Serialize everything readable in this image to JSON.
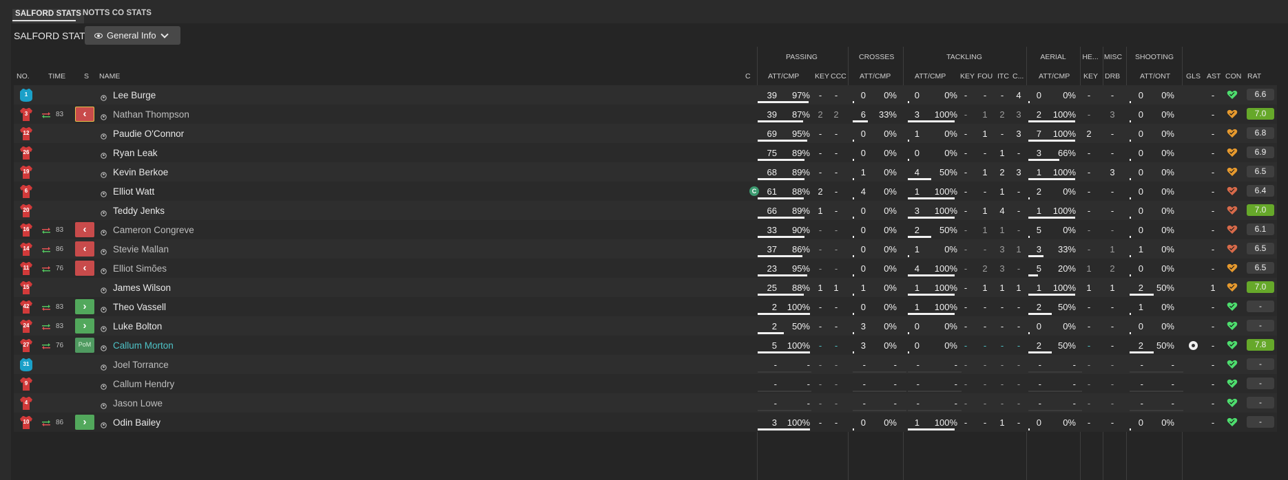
{
  "tabs": [
    {
      "label": "SALFORD STATS",
      "active": true
    },
    {
      "label": "NOTTS CO STATS",
      "active": false
    }
  ],
  "title": "SALFORD STATS",
  "view_selector": {
    "label": "General Info",
    "icon": "eye-icon"
  },
  "groups": {
    "passing": "PASSING",
    "crosses": "CROSSES",
    "tackling": "TACKLING",
    "aerial": "AERIAL",
    "headers": "HE...",
    "misc": "MISC",
    "shooting": "SHOOTING"
  },
  "columns": {
    "no": "NO.",
    "time": "TIME",
    "s": "S",
    "name": "NAME",
    "c": "C",
    "pass_att": "ATT/CMP",
    "key": "KEY",
    "ccc": "CCC",
    "cross_att": "ATT/CMP",
    "tack_att": "ATT/CMP",
    "tack_key": "KEY",
    "fou": "FOU",
    "itc": "ITC",
    "c2": "C...",
    "aerial_att": "ATT/CMP",
    "head_key": "KEY",
    "drb": "DRB",
    "shot_att": "ATT/ONT",
    "gls": "GLS",
    "ast": "AST",
    "con": "CON",
    "rat": "RAT"
  },
  "colors": {
    "shirt_red": "#d23a3a",
    "keeper_blue": "#1aa0c8",
    "sub_off": "#c84b4b",
    "sub_on": "#52a85c",
    "rating_green": "#66a82a",
    "pom_name": "#4ec3c7"
  },
  "players": [
    {
      "no": "1",
      "shirt": "keeper",
      "name": "Lee Burge",
      "swap": "",
      "time": "",
      "sub": "",
      "cap": false,
      "pa": "39",
      "pp": "97%",
      "pb": 0.97,
      "key": "-",
      "ccc": "-",
      "ca": "0",
      "cp": "0%",
      "cb": 0,
      "ta": "0",
      "tp": "0%",
      "tb": 0,
      "tk": "-",
      "fou": "-",
      "itc": "-",
      "c2": "4",
      "aa": "0",
      "ap": "0%",
      "ab": 0,
      "hk": "-",
      "drb": "-",
      "sa": "0",
      "sp": "0%",
      "sb": 0,
      "gls": "",
      "ast": "-",
      "con": "#4ede6e",
      "rat": "6.6",
      "ratg": false,
      "dim": false,
      "pom": false
    },
    {
      "no": "3",
      "shirt": "red",
      "name": "Nathan Thompson",
      "swap": "off",
      "time": "83",
      "sub": "off-hl",
      "cap": false,
      "pa": "39",
      "pp": "87%",
      "pb": 0.87,
      "key": "2",
      "ccc": "2",
      "ca": "6",
      "cp": "33%",
      "cb": 0.33,
      "ta": "3",
      "tp": "100%",
      "tb": 1,
      "tk": "-",
      "fou": "1",
      "itc": "2",
      "c2": "3",
      "aa": "2",
      "ap": "100%",
      "ab": 1,
      "hk": "-",
      "drb": "3",
      "sa": "0",
      "sp": "0%",
      "sb": 0,
      "gls": "",
      "ast": "-",
      "con": "#e79a2e",
      "rat": "7.0",
      "ratg": true,
      "dim": true,
      "pom": false
    },
    {
      "no": "12",
      "shirt": "red",
      "name": "Paudie O'Connor",
      "swap": "",
      "time": "",
      "sub": "",
      "cap": false,
      "pa": "69",
      "pp": "95%",
      "pb": 0.95,
      "key": "-",
      "ccc": "-",
      "ca": "0",
      "cp": "0%",
      "cb": 0,
      "ta": "1",
      "tp": "0%",
      "tb": 0,
      "tk": "-",
      "fou": "1",
      "itc": "-",
      "c2": "3",
      "aa": "7",
      "ap": "100%",
      "ab": 1,
      "hk": "2",
      "drb": "-",
      "sa": "0",
      "sp": "0%",
      "sb": 0,
      "gls": "",
      "ast": "-",
      "con": "#e79a2e",
      "rat": "6.8",
      "ratg": false,
      "dim": false,
      "pom": false
    },
    {
      "no": "26",
      "shirt": "red",
      "name": "Ryan Leak",
      "swap": "",
      "time": "",
      "sub": "",
      "cap": false,
      "pa": "75",
      "pp": "89%",
      "pb": 0.89,
      "key": "-",
      "ccc": "-",
      "ca": "0",
      "cp": "0%",
      "cb": 0,
      "ta": "0",
      "tp": "0%",
      "tb": 0,
      "tk": "-",
      "fou": "-",
      "itc": "1",
      "c2": "-",
      "aa": "3",
      "ap": "66%",
      "ab": 0.66,
      "hk": "-",
      "drb": "-",
      "sa": "0",
      "sp": "0%",
      "sb": 0,
      "gls": "",
      "ast": "-",
      "con": "#e79a2e",
      "rat": "6.9",
      "ratg": false,
      "dim": false,
      "pom": false
    },
    {
      "no": "19",
      "shirt": "red",
      "name": "Kevin Berkoe",
      "swap": "",
      "time": "",
      "sub": "",
      "cap": false,
      "pa": "68",
      "pp": "89%",
      "pb": 0.89,
      "key": "-",
      "ccc": "-",
      "ca": "1",
      "cp": "0%",
      "cb": 0,
      "ta": "4",
      "tp": "50%",
      "tb": 0.5,
      "tk": "-",
      "fou": "1",
      "itc": "2",
      "c2": "3",
      "aa": "1",
      "ap": "100%",
      "ab": 1,
      "hk": "-",
      "drb": "3",
      "sa": "0",
      "sp": "0%",
      "sb": 0,
      "gls": "",
      "ast": "-",
      "con": "#e79a2e",
      "rat": "6.5",
      "ratg": false,
      "dim": false,
      "pom": false
    },
    {
      "no": "6",
      "shirt": "red",
      "name": "Elliot Watt",
      "swap": "",
      "time": "",
      "sub": "",
      "cap": true,
      "cap_label": "C",
      "pa": "61",
      "pp": "88%",
      "pb": 0.88,
      "key": "2",
      "ccc": "-",
      "ca": "4",
      "cp": "0%",
      "cb": 0,
      "ta": "1",
      "tp": "100%",
      "tb": 1,
      "tk": "-",
      "fou": "-",
      "itc": "1",
      "c2": "-",
      "aa": "2",
      "ap": "0%",
      "ab": 0,
      "hk": "-",
      "drb": "-",
      "sa": "0",
      "sp": "0%",
      "sb": 0,
      "gls": "",
      "ast": "-",
      "con": "#d86a4a",
      "rat": "6.4",
      "ratg": false,
      "dim": false,
      "pom": false
    },
    {
      "no": "20",
      "shirt": "red",
      "name": "Teddy Jenks",
      "swap": "",
      "time": "",
      "sub": "",
      "cap": false,
      "pa": "66",
      "pp": "89%",
      "pb": 0.89,
      "key": "1",
      "ccc": "-",
      "ca": "0",
      "cp": "0%",
      "cb": 0,
      "ta": "3",
      "tp": "100%",
      "tb": 1,
      "tk": "-",
      "fou": "1",
      "itc": "4",
      "c2": "-",
      "aa": "1",
      "ap": "100%",
      "ab": 1,
      "hk": "-",
      "drb": "-",
      "sa": "0",
      "sp": "0%",
      "sb": 0,
      "gls": "",
      "ast": "-",
      "con": "#d86a4a",
      "rat": "7.0",
      "ratg": true,
      "dim": false,
      "pom": false
    },
    {
      "no": "16",
      "shirt": "red",
      "name": "Cameron Congreve",
      "swap": "off",
      "time": "83",
      "sub": "off",
      "cap": false,
      "pa": "33",
      "pp": "90%",
      "pb": 0.9,
      "key": "-",
      "ccc": "-",
      "ca": "0",
      "cp": "0%",
      "cb": 0,
      "ta": "2",
      "tp": "50%",
      "tb": 0.5,
      "tk": "-",
      "fou": "1",
      "itc": "1",
      "c2": "-",
      "aa": "5",
      "ap": "0%",
      "ab": 0,
      "hk": "-",
      "drb": "-",
      "sa": "0",
      "sp": "0%",
      "sb": 0,
      "gls": "",
      "ast": "-",
      "con": "#d86a4a",
      "rat": "6.1",
      "ratg": false,
      "dim": true,
      "pom": false
    },
    {
      "no": "14",
      "shirt": "red",
      "name": "Stevie Mallan",
      "swap": "off",
      "time": "86",
      "sub": "off",
      "cap": false,
      "pa": "37",
      "pp": "86%",
      "pb": 0.86,
      "key": "-",
      "ccc": "-",
      "ca": "0",
      "cp": "0%",
      "cb": 0,
      "ta": "1",
      "tp": "0%",
      "tb": 0,
      "tk": "-",
      "fou": "-",
      "itc": "3",
      "c2": "1",
      "aa": "3",
      "ap": "33%",
      "ab": 0.33,
      "hk": "-",
      "drb": "1",
      "sa": "1",
      "sp": "0%",
      "sb": 0,
      "gls": "",
      "ast": "-",
      "con": "#d86a4a",
      "rat": "6.5",
      "ratg": false,
      "dim": true,
      "pom": false
    },
    {
      "no": "11",
      "shirt": "red",
      "name": "Elliot Simões",
      "swap": "off",
      "time": "76",
      "sub": "off",
      "cap": false,
      "pa": "23",
      "pp": "95%",
      "pb": 0.95,
      "key": "-",
      "ccc": "-",
      "ca": "0",
      "cp": "0%",
      "cb": 0,
      "ta": "4",
      "tp": "100%",
      "tb": 1,
      "tk": "-",
      "fou": "2",
      "itc": "3",
      "c2": "-",
      "aa": "5",
      "ap": "20%",
      "ab": 0.2,
      "hk": "1",
      "drb": "2",
      "sa": "0",
      "sp": "0%",
      "sb": 0,
      "gls": "",
      "ast": "-",
      "con": "#e79a2e",
      "rat": "6.5",
      "ratg": false,
      "dim": true,
      "pom": false
    },
    {
      "no": "15",
      "shirt": "red",
      "name": "James Wilson",
      "swap": "",
      "time": "",
      "sub": "",
      "cap": false,
      "pa": "25",
      "pp": "88%",
      "pb": 0.88,
      "key": "1",
      "ccc": "1",
      "ca": "1",
      "cp": "0%",
      "cb": 0,
      "ta": "1",
      "tp": "100%",
      "tb": 1,
      "tk": "-",
      "fou": "1",
      "itc": "1",
      "c2": "1",
      "aa": "1",
      "ap": "100%",
      "ab": 1,
      "hk": "1",
      "drb": "1",
      "sa": "2",
      "sp": "50%",
      "sb": 0.5,
      "gls": "",
      "ast": "1",
      "con": "#e79a2e",
      "rat": "7.0",
      "ratg": true,
      "dim": false,
      "pom": false
    },
    {
      "no": "42",
      "shirt": "red",
      "name": "Theo Vassell",
      "swap": "on",
      "time": "83",
      "sub": "on",
      "cap": false,
      "pa": "2",
      "pp": "100%",
      "pb": 1,
      "key": "-",
      "ccc": "-",
      "ca": "0",
      "cp": "0%",
      "cb": 0,
      "ta": "1",
      "tp": "100%",
      "tb": 1,
      "tk": "-",
      "fou": "-",
      "itc": "-",
      "c2": "-",
      "aa": "2",
      "ap": "50%",
      "ab": 0.5,
      "hk": "-",
      "drb": "-",
      "sa": "1",
      "sp": "0%",
      "sb": 0,
      "gls": "",
      "ast": "-",
      "con": "#4ede6e",
      "rat": "-",
      "ratg": false,
      "dim": false,
      "pom": false
    },
    {
      "no": "24",
      "shirt": "red",
      "name": "Luke Bolton",
      "swap": "on",
      "time": "83",
      "sub": "on",
      "cap": false,
      "pa": "2",
      "pp": "50%",
      "pb": 0.5,
      "key": "-",
      "ccc": "-",
      "ca": "3",
      "cp": "0%",
      "cb": 0,
      "ta": "0",
      "tp": "0%",
      "tb": 0,
      "tk": "-",
      "fou": "-",
      "itc": "-",
      "c2": "-",
      "aa": "0",
      "ap": "0%",
      "ab": 0,
      "hk": "-",
      "drb": "-",
      "sa": "0",
      "sp": "0%",
      "sb": 0,
      "gls": "",
      "ast": "-",
      "con": "#4ede6e",
      "rat": "-",
      "ratg": false,
      "dim": false,
      "pom": false
    },
    {
      "no": "27",
      "shirt": "red",
      "name": "Callum Morton",
      "swap": "on",
      "time": "76",
      "sub": "pom",
      "sub_label": "PoM",
      "cap": false,
      "pa": "5",
      "pp": "100%",
      "pb": 1,
      "key": "-",
      "ccc": "-",
      "ca": "3",
      "cp": "0%",
      "cb": 0,
      "ta": "0",
      "tp": "0%",
      "tb": 0,
      "tk": "-",
      "fou": "-",
      "itc": "-",
      "c2": "-",
      "aa": "2",
      "ap": "50%",
      "ab": 0.5,
      "hk": "-",
      "drb": "-",
      "sa": "2",
      "sp": "50%",
      "sb": 0.5,
      "gls": "ball",
      "ast": "-",
      "con": "#4ede6e",
      "rat": "7.8",
      "ratg": true,
      "dim": false,
      "pom": true
    },
    {
      "no": "31",
      "shirt": "keeper",
      "name": "Joel Torrance",
      "swap": "",
      "time": "",
      "sub": "",
      "cap": false,
      "pa": "-",
      "pp": "-",
      "pb": 0,
      "key": "-",
      "ccc": "-",
      "ca": "-",
      "cp": "-",
      "cb": 0,
      "ta": "-",
      "tp": "-",
      "tb": 0,
      "tk": "-",
      "fou": "-",
      "itc": "-",
      "c2": "-",
      "aa": "-",
      "ap": "-",
      "ab": 0,
      "hk": "-",
      "drb": "-",
      "sa": "-",
      "sp": "-",
      "sb": 0,
      "gls": "",
      "ast": "-",
      "con": "#4ede6e",
      "rat": "-",
      "ratg": false,
      "dim": true,
      "pom": false
    },
    {
      "no": "9",
      "shirt": "red",
      "name": "Callum Hendry",
      "swap": "",
      "time": "",
      "sub": "",
      "cap": false,
      "pa": "-",
      "pp": "-",
      "pb": 0,
      "key": "-",
      "ccc": "-",
      "ca": "-",
      "cp": "-",
      "cb": 0,
      "ta": "-",
      "tp": "-",
      "tb": 0,
      "tk": "-",
      "fou": "-",
      "itc": "-",
      "c2": "-",
      "aa": "-",
      "ap": "-",
      "ab": 0,
      "hk": "-",
      "drb": "-",
      "sa": "-",
      "sp": "-",
      "sb": 0,
      "gls": "",
      "ast": "-",
      "con": "#4ede6e",
      "rat": "-",
      "ratg": false,
      "dim": true,
      "pom": false
    },
    {
      "no": "4",
      "shirt": "red",
      "name": "Jason Lowe",
      "swap": "",
      "time": "",
      "sub": "",
      "cap": false,
      "pa": "-",
      "pp": "-",
      "pb": 0,
      "key": "-",
      "ccc": "-",
      "ca": "-",
      "cp": "-",
      "cb": 0,
      "ta": "-",
      "tp": "-",
      "tb": 0,
      "tk": "-",
      "fou": "-",
      "itc": "-",
      "c2": "-",
      "aa": "-",
      "ap": "-",
      "ab": 0,
      "hk": "-",
      "drb": "-",
      "sa": "-",
      "sp": "-",
      "sb": 0,
      "gls": "",
      "ast": "-",
      "con": "#4ede6e",
      "rat": "-",
      "ratg": false,
      "dim": true,
      "pom": false
    },
    {
      "no": "10",
      "shirt": "red",
      "name": "Odin Bailey",
      "swap": "on",
      "time": "86",
      "sub": "on",
      "cap": false,
      "pa": "3",
      "pp": "100%",
      "pb": 1,
      "key": "-",
      "ccc": "-",
      "ca": "0",
      "cp": "0%",
      "cb": 0,
      "ta": "1",
      "tp": "100%",
      "tb": 1,
      "tk": "-",
      "fou": "-",
      "itc": "1",
      "c2": "-",
      "aa": "0",
      "ap": "0%",
      "ab": 0,
      "hk": "-",
      "drb": "-",
      "sa": "0",
      "sp": "0%",
      "sb": 0,
      "gls": "",
      "ast": "-",
      "con": "#4ede6e",
      "rat": "-",
      "ratg": false,
      "dim": false,
      "pom": false
    }
  ]
}
